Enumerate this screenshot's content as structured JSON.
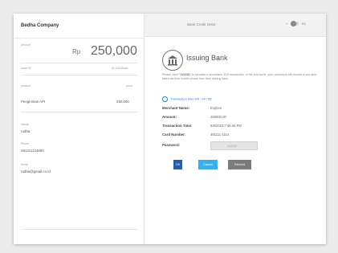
{
  "merchant_panel": {
    "company_name": "Bedha Company",
    "amount_label": "amount",
    "currency": "Rp",
    "amount": "250,000",
    "order_id_label": "order ID",
    "order_id_value": "ID-12345abc",
    "product_label": "product",
    "price_label": "price",
    "product_name": "Pengiriman API",
    "product_price": "250,000",
    "name_label": "Name",
    "name_value": "rudha",
    "phone_label": "Phone",
    "phone_value": "081311124600",
    "email_label": "Email",
    "email_value": "rudha@gmail.co.id"
  },
  "bank_panel": {
    "top_title": "Bank Credit Debit",
    "lang_selector": "EN",
    "bank_name": "Issuing Bank",
    "instruction_prefix": "Please input",
    "otp_code": "\"112233\"",
    "instruction_rest": "to simulate a successful 3DS transaction. In the real world, your customers will receive a one-time token via their mobile phone from their issuing bank.",
    "otp_timer_label": "Transaction time left :",
    "otp_timer_value": "04 : 58",
    "details": [
      {
        "label": "Merchant Name:",
        "value": "Explore"
      },
      {
        "label": "Amount:",
        "value": "250000.00"
      },
      {
        "label": "Transaction Time:",
        "value": "8/8/2023 7:46:46 PM"
      },
      {
        "label": "Card Number:",
        "value": "481111-1114"
      }
    ],
    "password_label": "Password:",
    "password_placeholder": "112233",
    "ok_label": "OK",
    "cancel_label": "Cancel",
    "resend_label": "Resend"
  },
  "colors": {
    "primary_button": "#2a5fa8",
    "cancel_button": "#3ab0e6",
    "resend_button": "#7b7b7b",
    "link_blue": "#2a7ad0"
  }
}
